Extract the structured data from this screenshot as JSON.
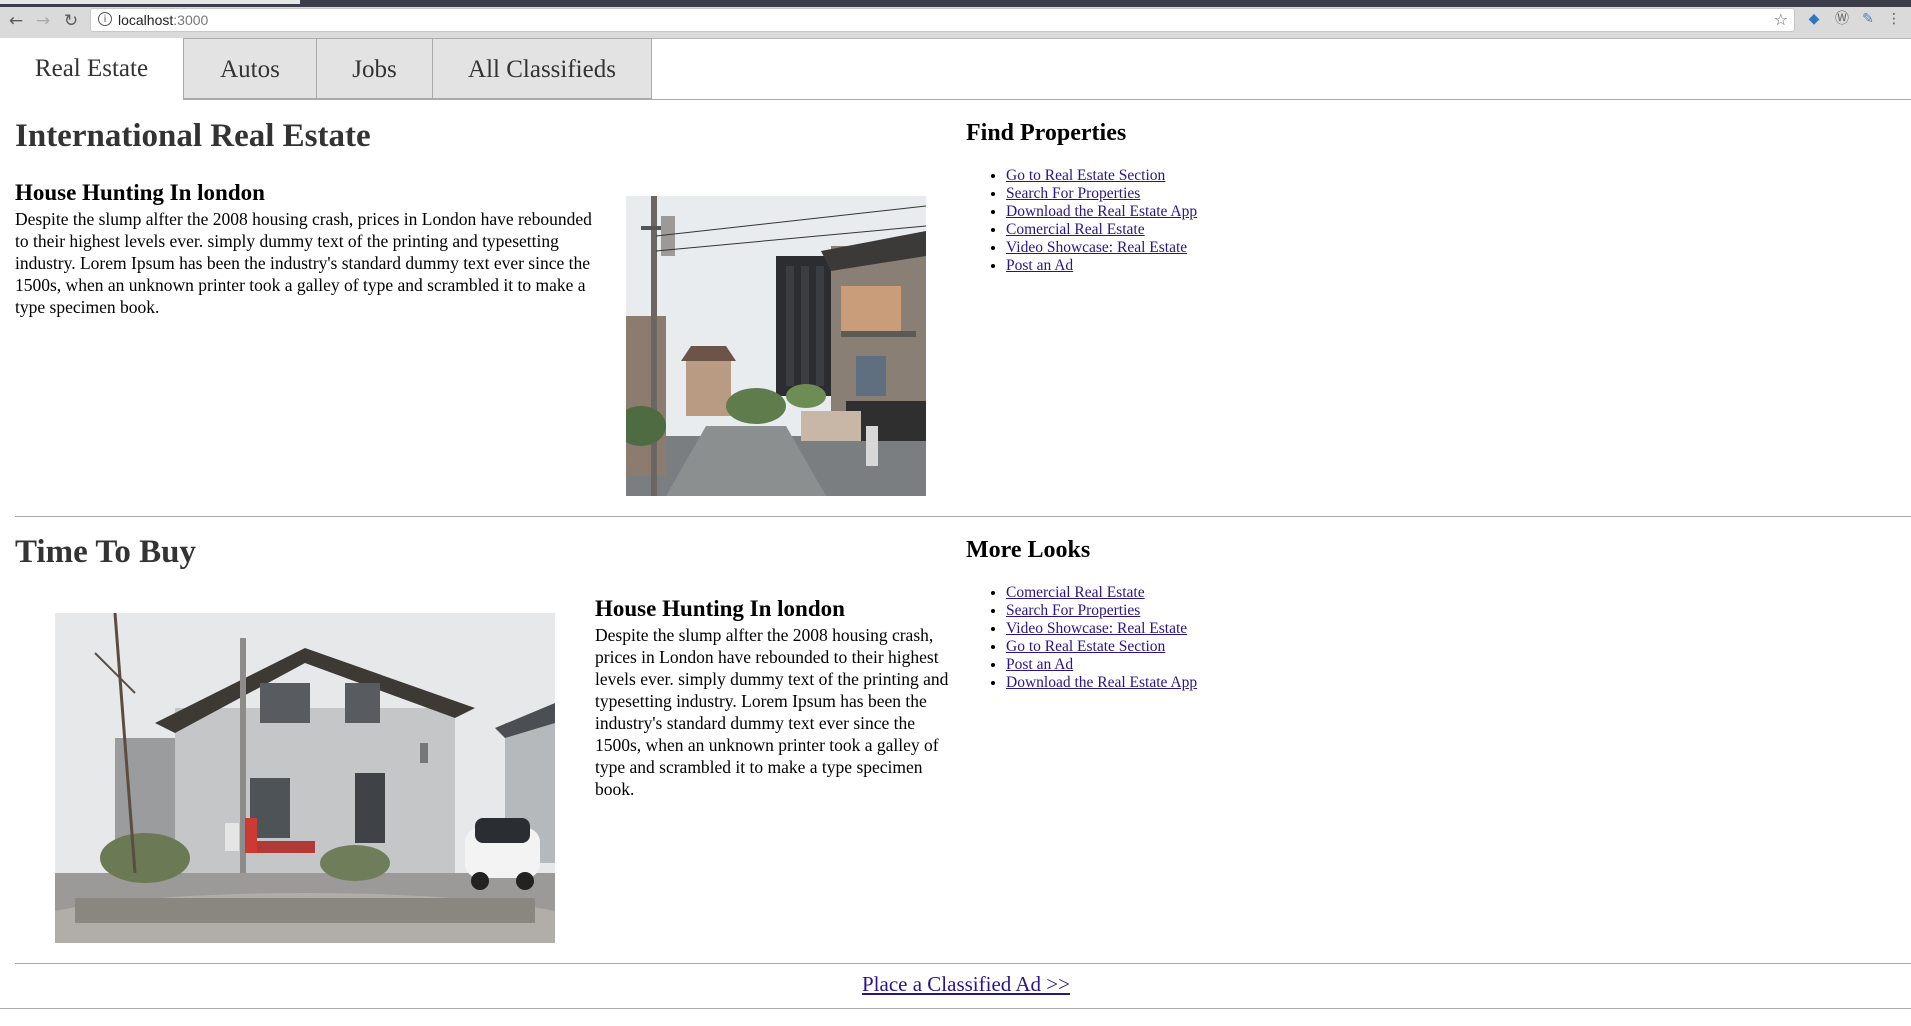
{
  "browser": {
    "url_host": "localhost",
    "url_port": ":3000",
    "back_icon": "arrow-left-icon",
    "forward_icon": "arrow-right-icon",
    "reload_icon": "reload-icon",
    "info_icon": "info-icon",
    "bookmark_icon": "star-icon",
    "menu_icon": "kebab-menu-icon"
  },
  "tabs": [
    {
      "label": "Real Estate",
      "active": true
    },
    {
      "label": "Autos",
      "active": false
    },
    {
      "label": "Jobs",
      "active": false
    },
    {
      "label": "All Classifieds",
      "active": false
    }
  ],
  "section1": {
    "title": "International Real Estate",
    "article": {
      "title": "House Hunting In london",
      "body": "Despite the slump alfter the 2008 housing crash, prices in London have rebounded to their highest levels ever. simply dummy text of the printing and typesetting industry. Lorem Ipsum has been the industry's standard dummy text ever since the 1500s, when an unknown printer took a galley of type and scrambled it to make a type specimen book."
    },
    "sidebar": {
      "title": "Find Properties",
      "links": [
        "Go to Real Estate Section",
        "Search For Properties",
        "Download the Real Estate App",
        "Comercial Real Estate",
        "Video Showcase: Real Estate",
        "Post an Ad"
      ]
    }
  },
  "section2": {
    "title": "Time To Buy",
    "article": {
      "title": "House Hunting In london",
      "body": "Despite the slump alfter the 2008 housing crash, prices in London have rebounded to their highest levels ever. simply dummy text of the printing and typesetting industry. Lorem Ipsum has been the industry's standard dummy text ever since the 1500s, when an unknown printer took a galley of type and scrambled it to make a type specimen book."
    },
    "sidebar": {
      "title": "More Looks",
      "links": [
        "Comercial Real Estate",
        "Search For Properties",
        "Video Showcase: Real Estate",
        "Go to Real Estate Section",
        "Post an Ad",
        "Download the Real Estate App"
      ]
    }
  },
  "cta": {
    "label": "Place a Classified Ad >>"
  },
  "colors": {
    "link": "#2a1488",
    "heading": "#333333",
    "tab_inactive": "#e3e3e3",
    "divider": "#aaaaaa"
  }
}
